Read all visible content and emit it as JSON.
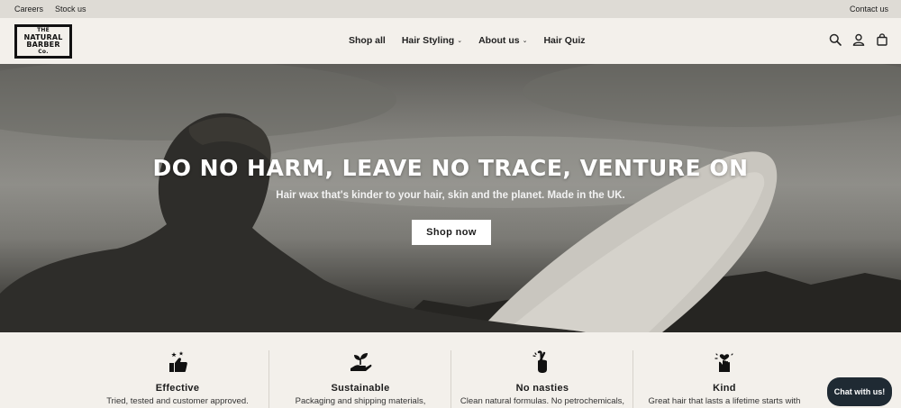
{
  "topbar": {
    "links": [
      "Careers",
      "Stock us"
    ],
    "contact": "Contact us"
  },
  "logo": {
    "lines": [
      "THE",
      "NATURAL",
      "BARBER",
      "Co."
    ]
  },
  "nav": {
    "items": [
      {
        "label": "Shop all",
        "dropdown": false
      },
      {
        "label": "Hair Styling",
        "dropdown": true
      },
      {
        "label": "About us",
        "dropdown": true
      },
      {
        "label": "Hair Quiz",
        "dropdown": false
      }
    ],
    "icons": [
      "search-icon",
      "account-icon",
      "cart-icon"
    ]
  },
  "hero": {
    "headline": "DO NO HARM, LEAVE NO TRACE, VENTURE ON",
    "subtitle": "Hair wax that's kinder to your hair, skin and the planet. Made in the UK.",
    "cta": "Shop now"
  },
  "features": [
    {
      "icon": "thumbs-up-stars-icon",
      "title": "Effective",
      "desc": "Tried, tested and customer approved."
    },
    {
      "icon": "hand-plant-icon",
      "title": "Sustainable",
      "desc": "Packaging and shipping materials,"
    },
    {
      "icon": "crossed-fingers-icon",
      "title": "No nasties",
      "desc": "Clean natural formulas. No petrochemicals,"
    },
    {
      "icon": "hand-heart-icon",
      "title": "Kind",
      "desc": "Great hair that lasts a lifetime starts with"
    }
  ],
  "chat": {
    "label": "Chat with us!"
  },
  "colors": {
    "background": "#f3f0eb",
    "topbar": "#dedbd5",
    "chat": "#1f2a33"
  }
}
